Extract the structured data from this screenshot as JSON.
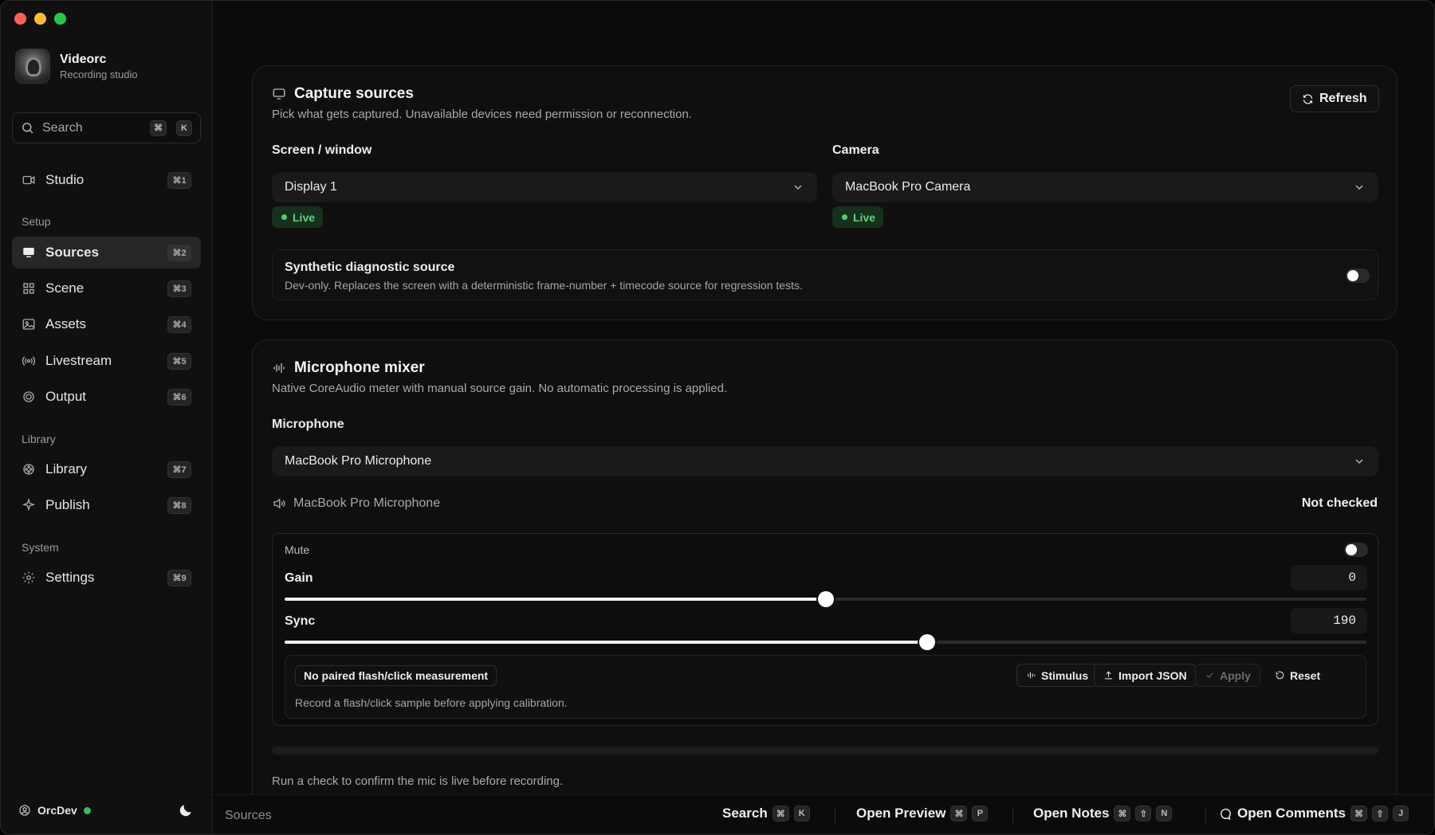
{
  "app": {
    "name": "Videorc",
    "subtitle": "Recording studio"
  },
  "sidebar": {
    "search": {
      "placeholder": "Search",
      "shortcut_mod": "⌘",
      "shortcut_key": "K"
    },
    "items": [
      {
        "label": "Studio",
        "shortcut": "⌘1",
        "icon": "video-camera-icon"
      },
      {
        "label": "Sources",
        "shortcut": "⌘2",
        "icon": "monitor-icon",
        "active": true
      },
      {
        "label": "Scene",
        "shortcut": "⌘3",
        "icon": "grid-icon"
      },
      {
        "label": "Assets",
        "shortcut": "⌘4",
        "icon": "image-icon"
      },
      {
        "label": "Livestream",
        "shortcut": "⌘5",
        "icon": "broadcast-icon"
      },
      {
        "label": "Output",
        "shortcut": "⌘6",
        "icon": "record-icon"
      },
      {
        "label": "Library",
        "shortcut": "⌘7",
        "icon": "film-reel-icon"
      },
      {
        "label": "Publish",
        "shortcut": "⌘8",
        "icon": "sparkle-icon"
      },
      {
        "label": "Settings",
        "shortcut": "⌘9",
        "icon": "gear-icon"
      }
    ],
    "groups": {
      "setup": "Setup",
      "library": "Library",
      "system": "System"
    },
    "user": {
      "name": "OrcDev",
      "status_color": "#2fc05a"
    }
  },
  "capture": {
    "title": "Capture sources",
    "description": "Pick what gets captured. Unavailable devices need permission or reconnection.",
    "refresh_label": "Refresh",
    "screen": {
      "label": "Screen / window",
      "value": "Display 1",
      "status": "Live"
    },
    "camera": {
      "label": "Camera",
      "value": "MacBook Pro Camera",
      "status": "Live"
    },
    "synthetic": {
      "title": "Synthetic diagnostic source",
      "description": "Dev-only. Replaces the screen with a deterministic frame-number + timecode source for regression tests.",
      "enabled": false
    }
  },
  "mixer": {
    "title": "Microphone mixer",
    "description": "Native CoreAudio meter with manual source gain. No automatic processing is applied.",
    "microphone_label": "Microphone",
    "microphone_value": "MacBook Pro Microphone",
    "device_name": "MacBook Pro Microphone",
    "check_status": "Not checked",
    "mute_label": "Mute",
    "mute_enabled": false,
    "gain": {
      "label": "Gain",
      "value": "0",
      "position_fraction": 0.5
    },
    "sync": {
      "label": "Sync",
      "value": "190",
      "position_fraction": 0.594
    },
    "calibration": {
      "badge": "No paired flash/click measurement",
      "hint": "Record a flash/click sample before applying calibration.",
      "stimulus_label": "Stimulus",
      "import_label": "Import JSON",
      "apply_label": "Apply",
      "reset_label": "Reset"
    },
    "footer_hint": "Run a check to confirm the mic is live before recording."
  },
  "statusbar": {
    "crumb": "Sources",
    "commands": [
      {
        "label": "Search",
        "keys": [
          "⌘",
          "K"
        ]
      },
      {
        "label": "Open Preview",
        "keys": [
          "⌘",
          "P"
        ]
      },
      {
        "label": "Open Notes",
        "keys": [
          "⌘",
          "⇧",
          "N"
        ]
      },
      {
        "label": "Open Comments",
        "keys": [
          "⌘",
          "⇧",
          "J"
        ]
      }
    ]
  }
}
